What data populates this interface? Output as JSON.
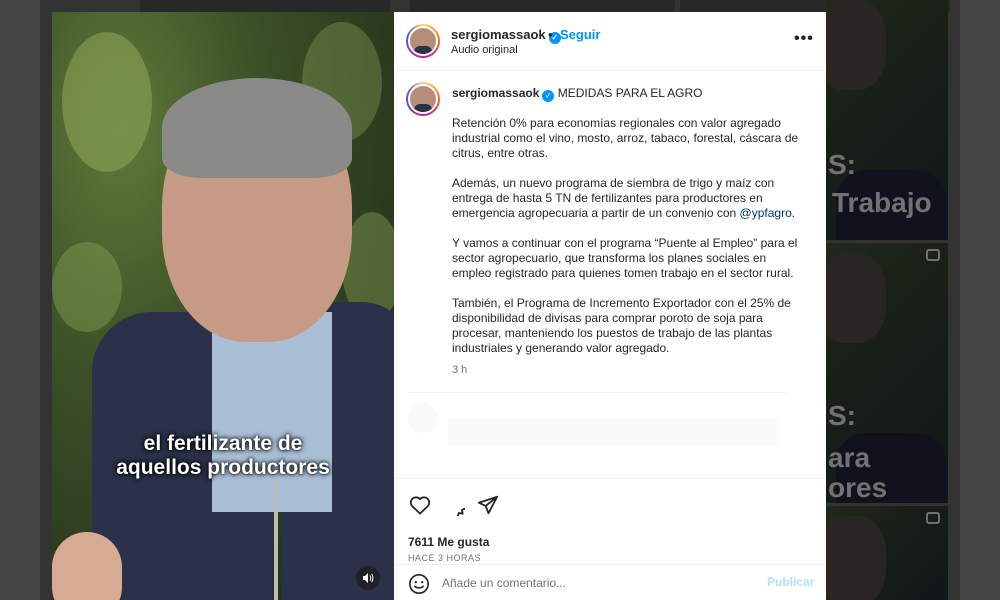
{
  "post": {
    "username": "sergiomassaok",
    "follow_label": "Seguir",
    "audio_label": "Audio original",
    "more_label": "•••",
    "caption_title": "MEDIDAS PARA EL AGRO",
    "paragraphs": [
      "Retención 0% para economías regionales con valor agregado industrial como el vino, mosto, arroz, tabaco, forestal, cáscara de citrus, entre otras.",
      "Además, un nuevo programa de siembra de trigo y maíz con entrega de hasta 5 TN de fertilizantes para productores en emergencia agropecuaria a partir de un convenio con",
      "Y vamos a continuar con el programa “Puente al Empleo” para el sector agropecuario, que transforma los planes sociales en empleo registrado para quienes tomen trabajo en el sector rural.",
      "También, el Programa de Incremento Exportador con el 25% de disponibilidad de divisas para comprar poroto de soja para procesar, manteniendo los puestos de trabajo de las plantas industriales y generando valor agregado."
    ],
    "mention": "@ypfagro",
    "mention_suffix": ".",
    "time": "3 h",
    "likes": "7611 Me gusta",
    "ago": "HACE 3 HORAS"
  },
  "video": {
    "subtitle_line1": "el fertilizante de",
    "subtitle_line2": "aquellos productores"
  },
  "comment": {
    "placeholder": "Añade un comentario...",
    "post_label": "Publicar"
  },
  "background_tiles": {
    "tile1_text_line1": "S:",
    "tile1_text_line2": "Trabajo",
    "tile2_text_line1": "S:",
    "tile2_text_line2": "ara",
    "tile2_text_line3": "ores"
  },
  "colors": {
    "accent": "#0095f6",
    "text": "#262626",
    "muted": "#737373",
    "mention": "#00376b",
    "post_disabled": "#b2dffc"
  },
  "icons": {
    "verified": "verified-badge-icon",
    "like": "heart-icon",
    "comment": "comment-icon",
    "share": "send-icon",
    "emoji": "emoji-icon",
    "sound": "speaker-icon",
    "more": "more-dots-icon"
  }
}
